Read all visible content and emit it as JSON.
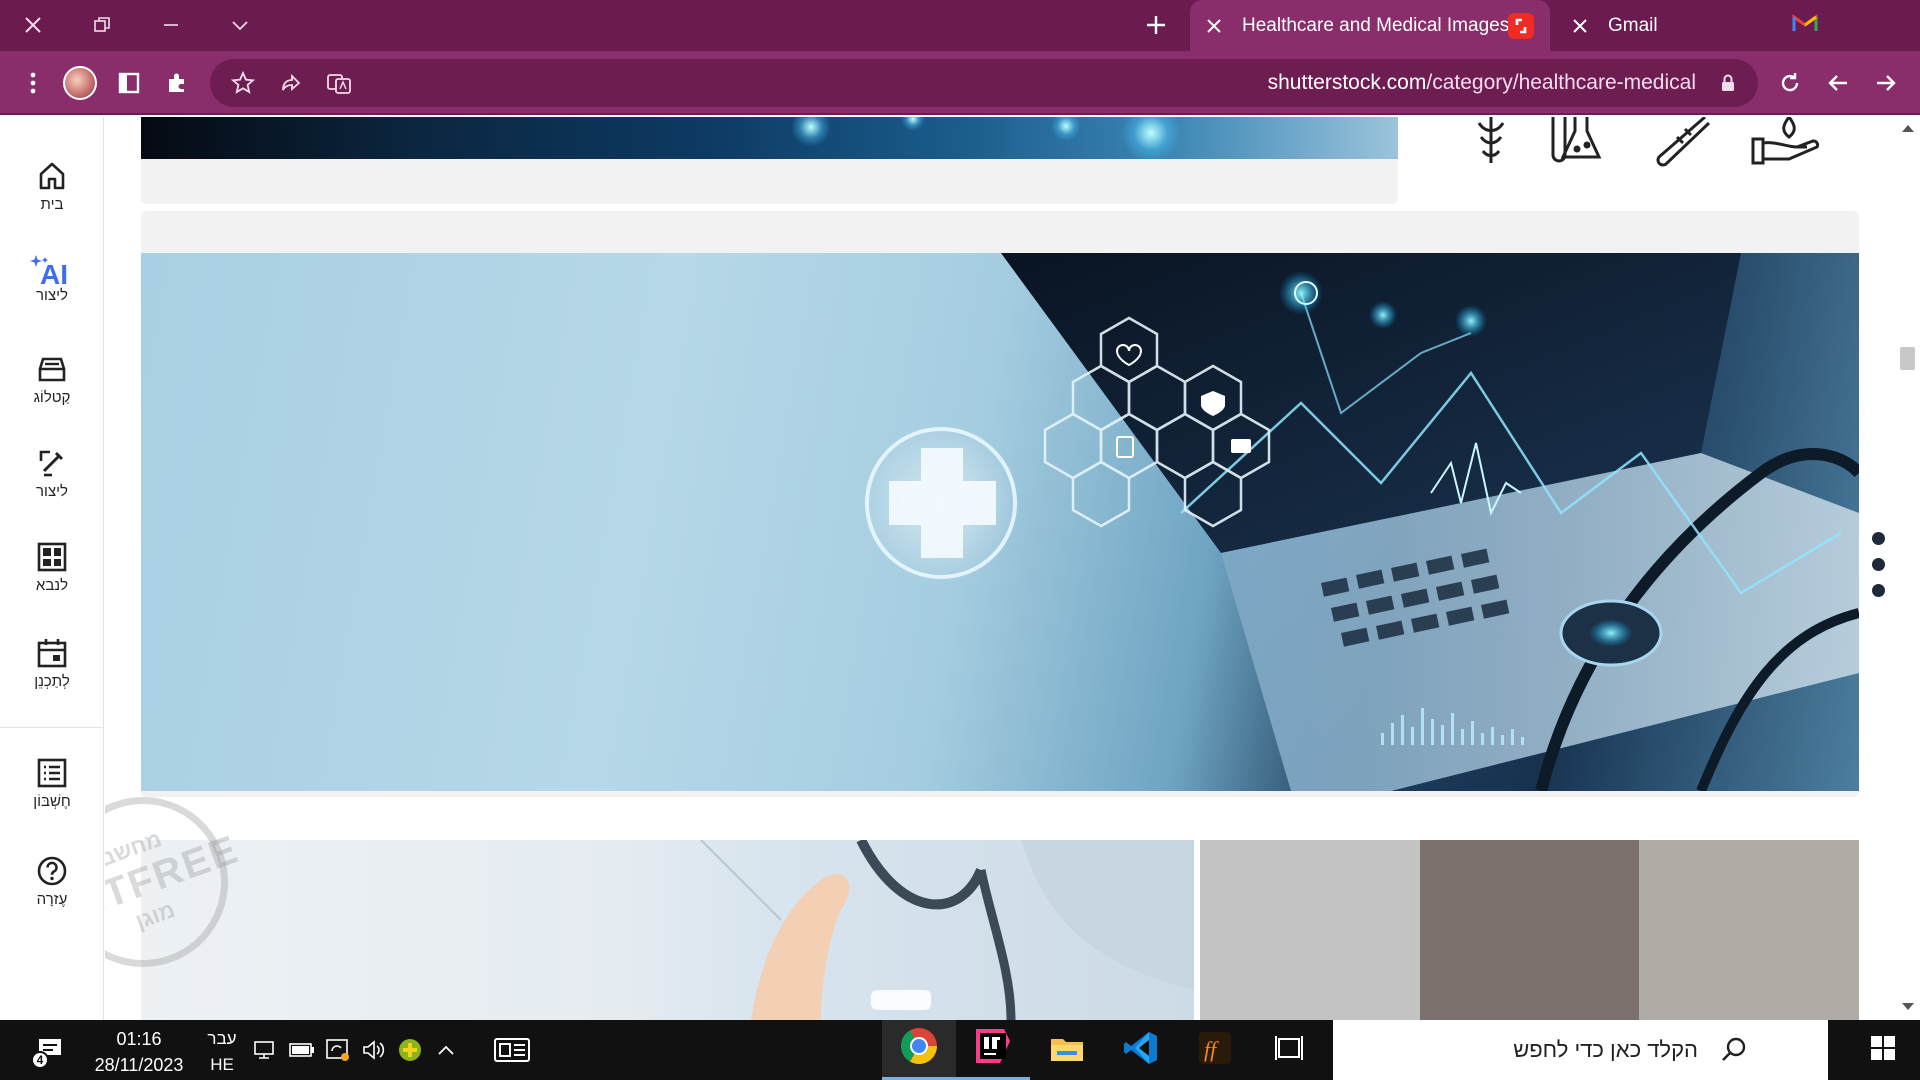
{
  "browser": {
    "tabs": [
      {
        "title": "Healthcare and Medical Images,",
        "active": true,
        "favicon": "shutterstock-icon"
      },
      {
        "title": "Gmail",
        "active": false,
        "favicon": "gmail-icon"
      }
    ],
    "url_host": "shutterstock.com",
    "url_path": "/category/healthcare-medical",
    "colors": {
      "frame": "#6b1b4f",
      "toolbar": "#8a2d6b"
    }
  },
  "sidebar": {
    "items": [
      {
        "label": "בית",
        "icon": "home-icon"
      },
      {
        "label": "ליצור",
        "icon": "ai-sparkle-icon",
        "ai_text": "AI"
      },
      {
        "label": "קַטלוֹג",
        "icon": "catalog-icon"
      },
      {
        "label": "ליצור",
        "icon": "edit-pencil-icon"
      },
      {
        "label": "לנבא",
        "icon": "dashboard-icon"
      },
      {
        "label": "לְתַכְנֵן",
        "icon": "calendar-icon"
      },
      {
        "label": "חֶשְׁבּוֹן",
        "icon": "account-list-icon"
      },
      {
        "label": "עֶזרָה",
        "icon": "help-icon"
      }
    ]
  },
  "watermark": {
    "line1": "מחשב",
    "line2": "NETFREE",
    "line3": "מוגן"
  },
  "hero": {
    "alt": "laptop with stethoscope and medical icons"
  },
  "taskbar": {
    "notification_count": "4",
    "time": "01:16",
    "date": "28/11/2023",
    "lang_top": "עבר",
    "lang_bottom": "HE",
    "search_placeholder": "הקלד כאן כדי לחפש",
    "apps": [
      "chrome-icon",
      "intellij-icon",
      "file-explorer-icon",
      "vscode-icon",
      "font-app-icon",
      "task-view-icon"
    ]
  }
}
